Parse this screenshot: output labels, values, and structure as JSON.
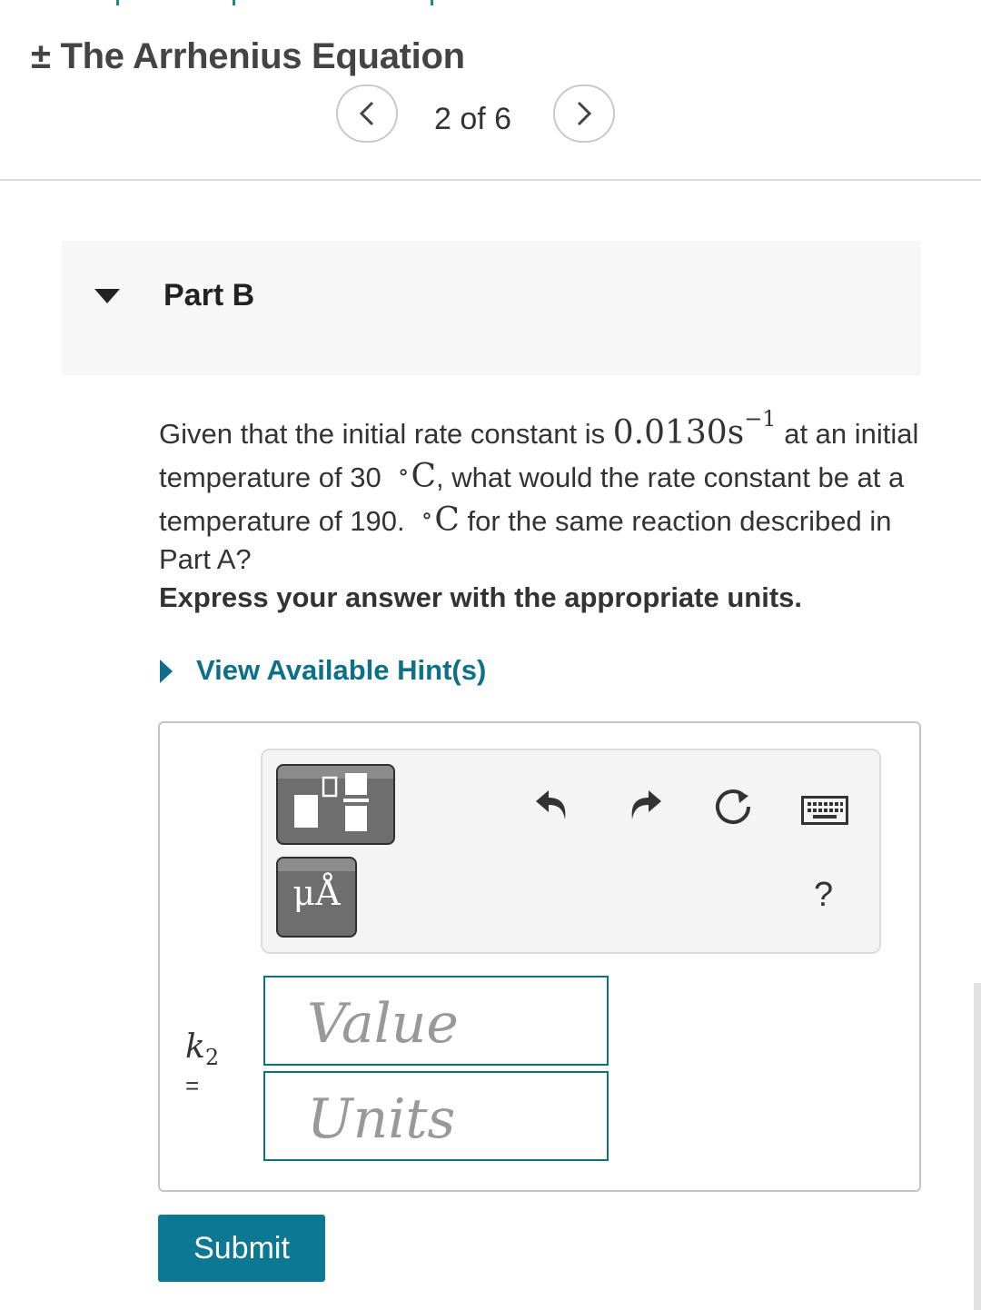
{
  "header": {
    "title": "± The Arrhenius Equation",
    "page_indicator": "2 of 6",
    "prev_icon": "chevron-left-icon",
    "next_icon": "chevron-right-icon"
  },
  "part": {
    "label": "Part B",
    "caret_icon": "caret-down-icon"
  },
  "question": {
    "text_1": "Given that the initial rate constant is",
    "rate_value": "0.0130s",
    "rate_exponent": "−1",
    "text_2": "at an initial temperature of 30",
    "unit_1": "C",
    "text_3": ", what would the rate constant be at a temperature of 190.",
    "unit_2": "C",
    "text_4": "for the same reaction described in Part A?",
    "degree_symbol": "∘"
  },
  "instruction": "Express your answer with the appropriate units.",
  "hint": {
    "label": "View Available Hint(s)",
    "caret_icon": "caret-right-icon"
  },
  "toolbar": {
    "template_icon": "fraction-template-icon",
    "units_label": "μÅ",
    "undo_icon": "undo-icon",
    "redo_icon": "redo-icon",
    "reset_icon": "reset-icon",
    "keyboard_icon": "keyboard-icon",
    "help_label": "?"
  },
  "answer": {
    "variable": "k",
    "subscript": "2",
    "equals": "=",
    "value_placeholder": "Value",
    "units_placeholder": "Units"
  },
  "submit_label": "Submit",
  "colors": {
    "accent": "#0d7893",
    "link": "#0d6f8a",
    "field_border": "#0f6f7c"
  }
}
